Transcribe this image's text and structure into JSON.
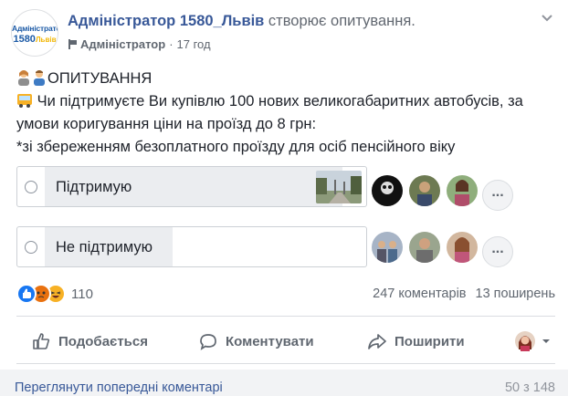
{
  "header": {
    "page_name": "Адміністратор 1580_Львів",
    "action": "створює опитування.",
    "role": "Адміністратор",
    "separator": "·",
    "time": "17 год"
  },
  "avatar": {
    "line1": "Адміністратор",
    "line2": "1580",
    "line2_suffix": "Львів"
  },
  "post": {
    "heading": "ОПИТУВАННЯ",
    "line1": " Чи підтримуєте Ви купівлю 100 нових великогабаритних автобусів, за",
    "line2": "умови коригування ціни на проїзд до 8 грн:",
    "line3": "*зі збереженням безоплатного проїзду для осіб пенсійного віку"
  },
  "poll": {
    "options": [
      {
        "label": "Підтримую",
        "fill_fraction": 0.86
      },
      {
        "label": "Не підтримую",
        "fill_fraction": 0.36
      }
    ],
    "more": "..."
  },
  "stats": {
    "reactions_count": "110",
    "comments": "247 коментарів",
    "shares": "13 поширень"
  },
  "actions": {
    "like": "Подобається",
    "comment": "Коментувати",
    "share": "Поширити"
  },
  "comments_bar": {
    "view_previous": "Переглянути попередні коментарі",
    "count": "50 з 148"
  },
  "colors": {
    "link": "#385898",
    "muted": "#606770",
    "poll_fill": "#ebedf0",
    "like_blue": "#1877f2",
    "angry": "#e9710f",
    "haha": "#f7b125"
  },
  "icons": [
    "people-emoji-icon",
    "bus-emoji-icon",
    "flag-icon",
    "chevron-down-icon",
    "like-icon",
    "comment-icon",
    "share-icon"
  ]
}
